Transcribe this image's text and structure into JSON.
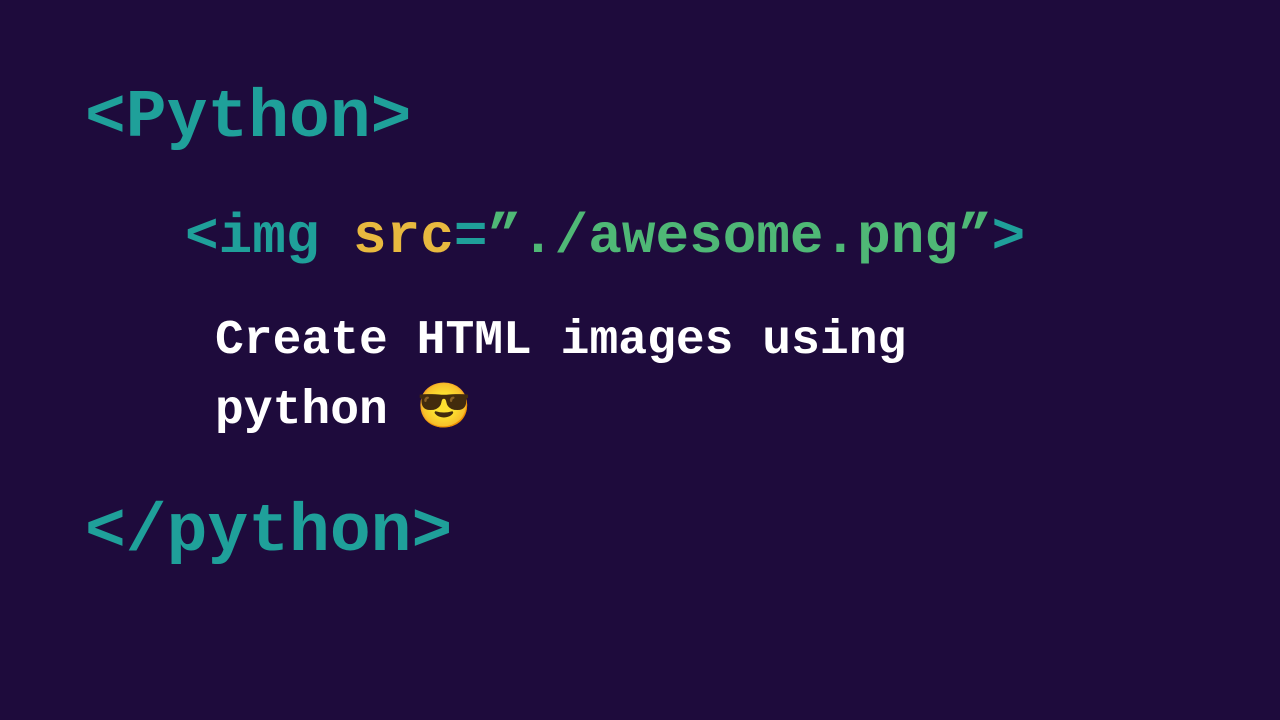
{
  "opening_tag": "<Python>",
  "img_open": "<img ",
  "img_attr": "src",
  "img_equals": "=",
  "img_value": "”./awesome.png”",
  "img_close": ">",
  "description_line1": "Create HTML images using",
  "description_line2": "python ",
  "emoji": "😎",
  "closing_tag": "</python>"
}
